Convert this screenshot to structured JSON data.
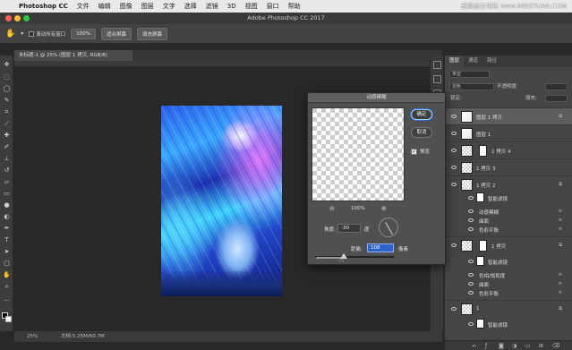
{
  "menubar": {
    "app": "Photoshop CC",
    "items": [
      "文件",
      "编辑",
      "图像",
      "图层",
      "文字",
      "选择",
      "滤镜",
      "3D",
      "视图",
      "窗口",
      "帮助"
    ],
    "watermark": "思缘设计论坛 www.MISSYUAN.COM"
  },
  "window": {
    "title": "Adobe Photoshop CC 2017"
  },
  "options_bar": {
    "scroll_all_label": "滚动所有窗口",
    "zoom_value": "100%",
    "fit_screen_label": "适合屏幕",
    "fill_screen_label": "填充屏幕"
  },
  "document": {
    "tab_label": "未标题-1 @ 25% (图层 1 拷贝, RGB/8)"
  },
  "status_bar": {
    "zoom": "25%",
    "doc_info": "文档:5.25M/60.7M"
  },
  "dialog": {
    "title": "动感模糊",
    "ok_label": "确定",
    "cancel_label": "取消",
    "preview_label": "预览",
    "preview_checked": true,
    "zoom_value": "100%",
    "angle_label": "角度:",
    "angle_value": "-30",
    "angle_unit": "度",
    "distance_label": "距离:",
    "distance_value": "108",
    "distance_unit": "像素",
    "distance_slider_fraction": 0.36
  },
  "layers_panel": {
    "tabs": [
      "图层",
      "通道",
      "路径"
    ],
    "filter_label": "类型",
    "blend_mode": "滤色",
    "opacity_label": "不透明度:",
    "lock_label": "锁定:",
    "fill_label": "填充:",
    "layers": [
      {
        "name": "图层 1 拷贝",
        "selected": true
      },
      {
        "name": "图层 1",
        "selected": false
      },
      {
        "name": "1 拷贝 4",
        "selected": false
      },
      {
        "name": "1 拷贝 3",
        "selected": false
      },
      {
        "name": "1 拷贝 2",
        "selected": false
      }
    ],
    "smart_filters_a": {
      "label": "智能滤镜",
      "items": [
        "动感模糊",
        "曲面",
        "色彩平衡"
      ]
    },
    "layer_copy": {
      "name": "1 拷贝"
    },
    "smart_filters_b": {
      "label": "智能滤镜",
      "items": [
        "色相/饱和度",
        "曲面",
        "色彩平衡"
      ]
    },
    "layer_1": {
      "name": "1"
    },
    "smart_filters_c": {
      "label": "智能滤镜"
    }
  },
  "colors": {
    "foreground": "#000000",
    "background": "#ffffff",
    "accent": "#2c63c7"
  }
}
